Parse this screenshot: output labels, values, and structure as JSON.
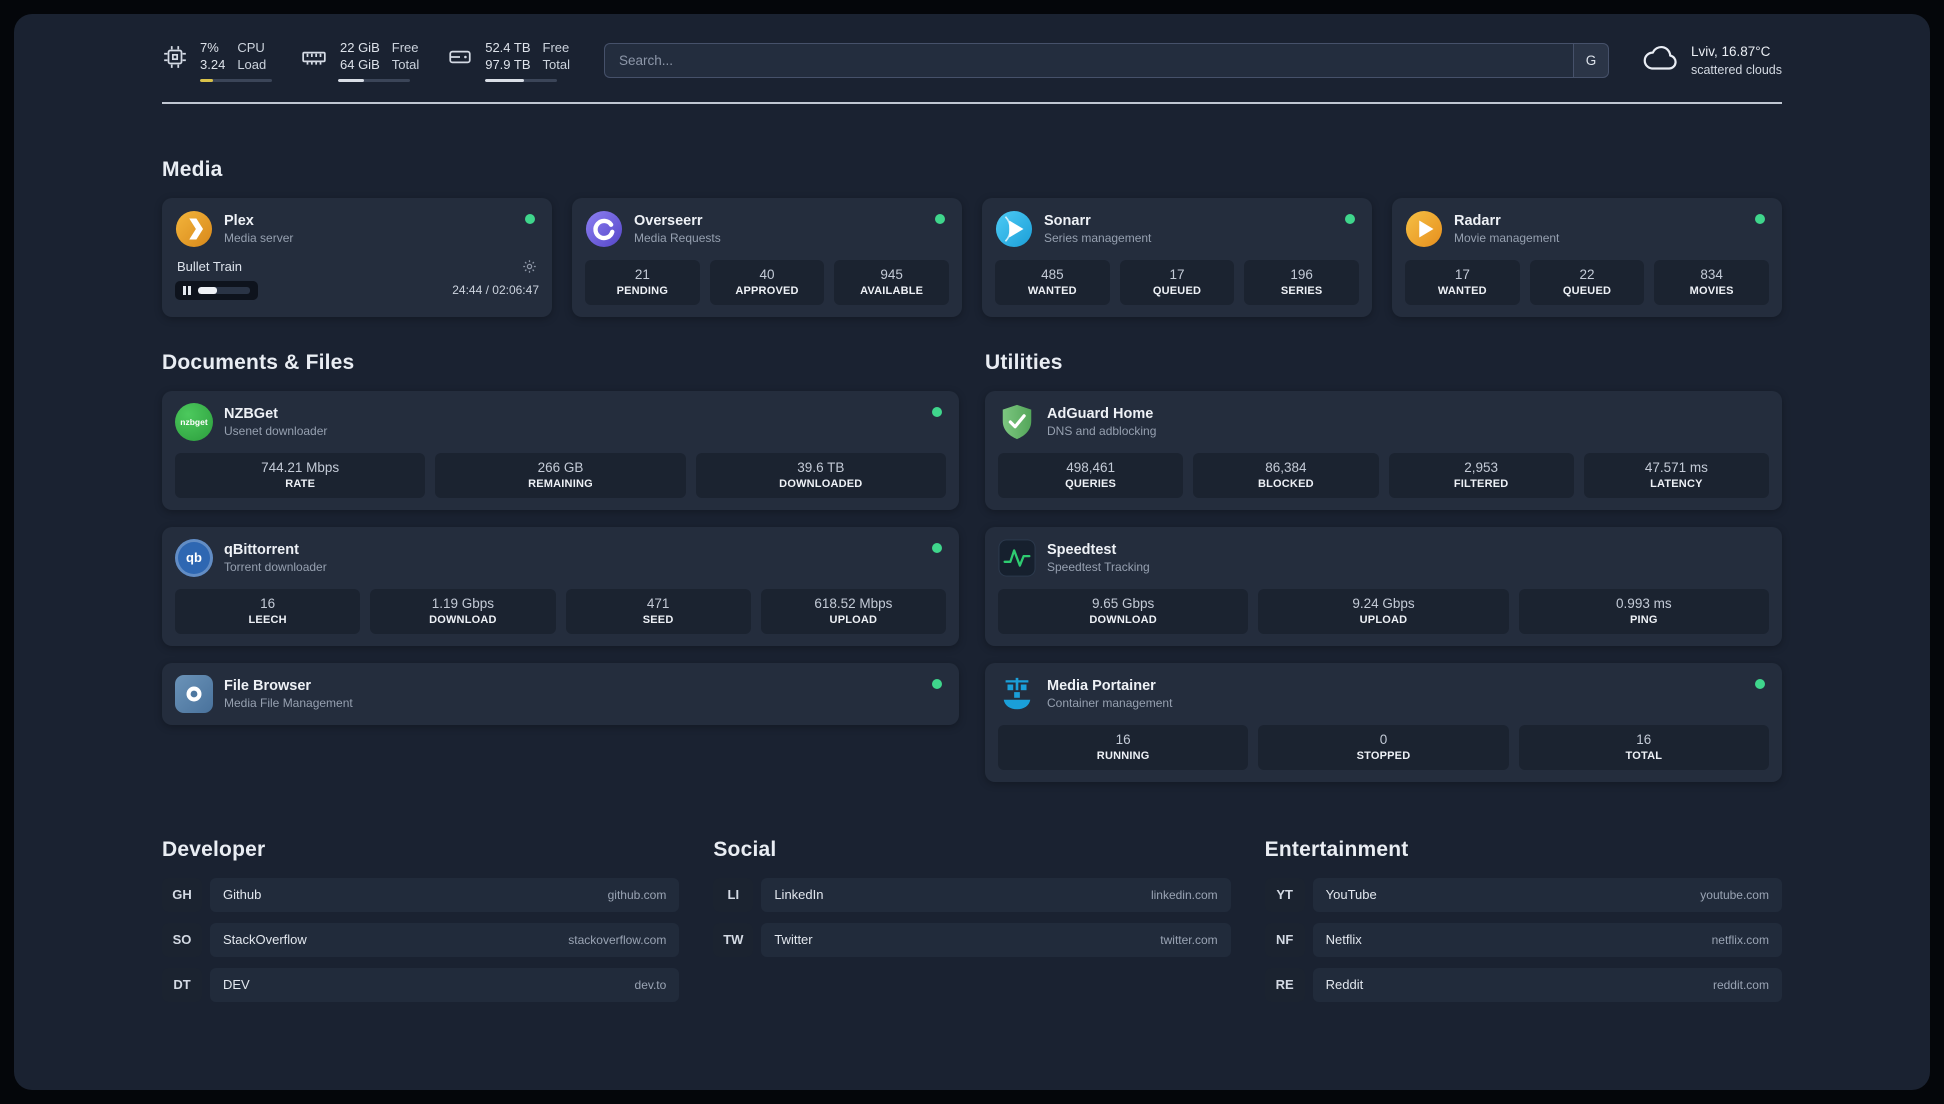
{
  "topbar": {
    "resources": [
      {
        "icon": "cpu-icon",
        "value_top": "7%",
        "value_bottom": "3.24",
        "label_top": "CPU",
        "label_bottom": "Load",
        "bar_fill": "18%",
        "bar_color": "#d9c24a"
      },
      {
        "icon": "memory-icon",
        "value_top": "22 GiB",
        "value_bottom": "64 GiB",
        "label_top": "Free",
        "label_bottom": "Total",
        "bar_fill": "36%",
        "bar_color": "#d9dee6"
      },
      {
        "icon": "disk-icon",
        "value_top": "52.4 TB",
        "value_bottom": "97.9 TB",
        "label_top": "Free",
        "label_bottom": "Total",
        "bar_fill": "54%",
        "bar_color": "#d9dee6"
      }
    ],
    "search": {
      "placeholder": "Search...",
      "button": "G"
    },
    "weather": {
      "icon": "cloud-icon",
      "location": "Lviv, 16.87°C",
      "condition": "scattered clouds"
    }
  },
  "sections": {
    "media": {
      "title": "Media",
      "services": [
        {
          "icon": "plex-icon",
          "name": "Plex",
          "desc": "Media server",
          "online": true,
          "player": {
            "title": "Bullet Train",
            "time": "24:44 / 02:06:47",
            "progress": "38%"
          }
        },
        {
          "icon": "overseerr-icon",
          "name": "Overseerr",
          "desc": "Media Requests",
          "online": true,
          "stats": [
            {
              "value": "21",
              "label": "PENDING"
            },
            {
              "value": "40",
              "label": "APPROVED"
            },
            {
              "value": "945",
              "label": "AVAILABLE"
            }
          ]
        },
        {
          "icon": "sonarr-icon",
          "name": "Sonarr",
          "desc": "Series management",
          "online": true,
          "stats": [
            {
              "value": "485",
              "label": "WANTED"
            },
            {
              "value": "17",
              "label": "QUEUED"
            },
            {
              "value": "196",
              "label": "SERIES"
            }
          ]
        },
        {
          "icon": "radarr-icon",
          "name": "Radarr",
          "desc": "Movie management",
          "online": true,
          "stats": [
            {
              "value": "17",
              "label": "WANTED"
            },
            {
              "value": "22",
              "label": "QUEUED"
            },
            {
              "value": "834",
              "label": "MOVIES"
            }
          ]
        }
      ]
    },
    "documents": {
      "title": "Documents & Files",
      "services": [
        {
          "icon": "nzbget-icon",
          "icon_label": "nzbget",
          "name": "NZBGet",
          "desc": "Usenet downloader",
          "online": true,
          "stats": [
            {
              "value": "744.21 Mbps",
              "label": "RATE"
            },
            {
              "value": "266 GB",
              "label": "REMAINING"
            },
            {
              "value": "39.6 TB",
              "label": "DOWNLOADED"
            }
          ]
        },
        {
          "icon": "qbittorrent-icon",
          "icon_label": "qb",
          "name": "qBittorrent",
          "desc": "Torrent downloader",
          "online": true,
          "stats": [
            {
              "value": "16",
              "label": "LEECH"
            },
            {
              "value": "1.19 Gbps",
              "label": "DOWNLOAD"
            },
            {
              "value": "471",
              "label": "SEED"
            },
            {
              "value": "618.52 Mbps",
              "label": "UPLOAD"
            }
          ]
        },
        {
          "icon": "filebrowser-icon",
          "name": "File Browser",
          "desc": "Media File Management",
          "online": true,
          "stats": []
        }
      ]
    },
    "utilities": {
      "title": "Utilities",
      "services": [
        {
          "icon": "adguard-icon",
          "name": "AdGuard Home",
          "desc": "DNS and adblocking",
          "online": false,
          "stats": [
            {
              "value": "498,461",
              "label": "QUERIES"
            },
            {
              "value": "86,384",
              "label": "BLOCKED"
            },
            {
              "value": "2,953",
              "label": "FILTERED"
            },
            {
              "value": "47.571 ms",
              "label": "LATENCY"
            }
          ]
        },
        {
          "icon": "speedtest-icon",
          "name": "Speedtest",
          "desc": "Speedtest Tracking",
          "online": false,
          "stats": [
            {
              "value": "9.65 Gbps",
              "label": "DOWNLOAD"
            },
            {
              "value": "9.24 Gbps",
              "label": "UPLOAD"
            },
            {
              "value": "0.993 ms",
              "label": "PING"
            }
          ]
        },
        {
          "icon": "portainer-icon",
          "name": "Media Portainer",
          "desc": "Container management",
          "online": true,
          "stats": [
            {
              "value": "16",
              "label": "RUNNING"
            },
            {
              "value": "0",
              "label": "STOPPED"
            },
            {
              "value": "16",
              "label": "TOTAL"
            }
          ]
        }
      ]
    }
  },
  "bookmarks": [
    {
      "title": "Developer",
      "items": [
        {
          "abbr": "GH",
          "name": "Github",
          "url": "github.com"
        },
        {
          "abbr": "SO",
          "name": "StackOverflow",
          "url": "stackoverflow.com"
        },
        {
          "abbr": "DT",
          "name": "DEV",
          "url": "dev.to"
        }
      ]
    },
    {
      "title": "Social",
      "items": [
        {
          "abbr": "LI",
          "name": "LinkedIn",
          "url": "linkedin.com"
        },
        {
          "abbr": "TW",
          "name": "Twitter",
          "url": "twitter.com"
        }
      ]
    },
    {
      "title": "Entertainment",
      "items": [
        {
          "abbr": "YT",
          "name": "YouTube",
          "url": "youtube.com"
        },
        {
          "abbr": "NF",
          "name": "Netflix",
          "url": "netflix.com"
        },
        {
          "abbr": "RE",
          "name": "Reddit",
          "url": "reddit.com"
        }
      ]
    }
  ]
}
